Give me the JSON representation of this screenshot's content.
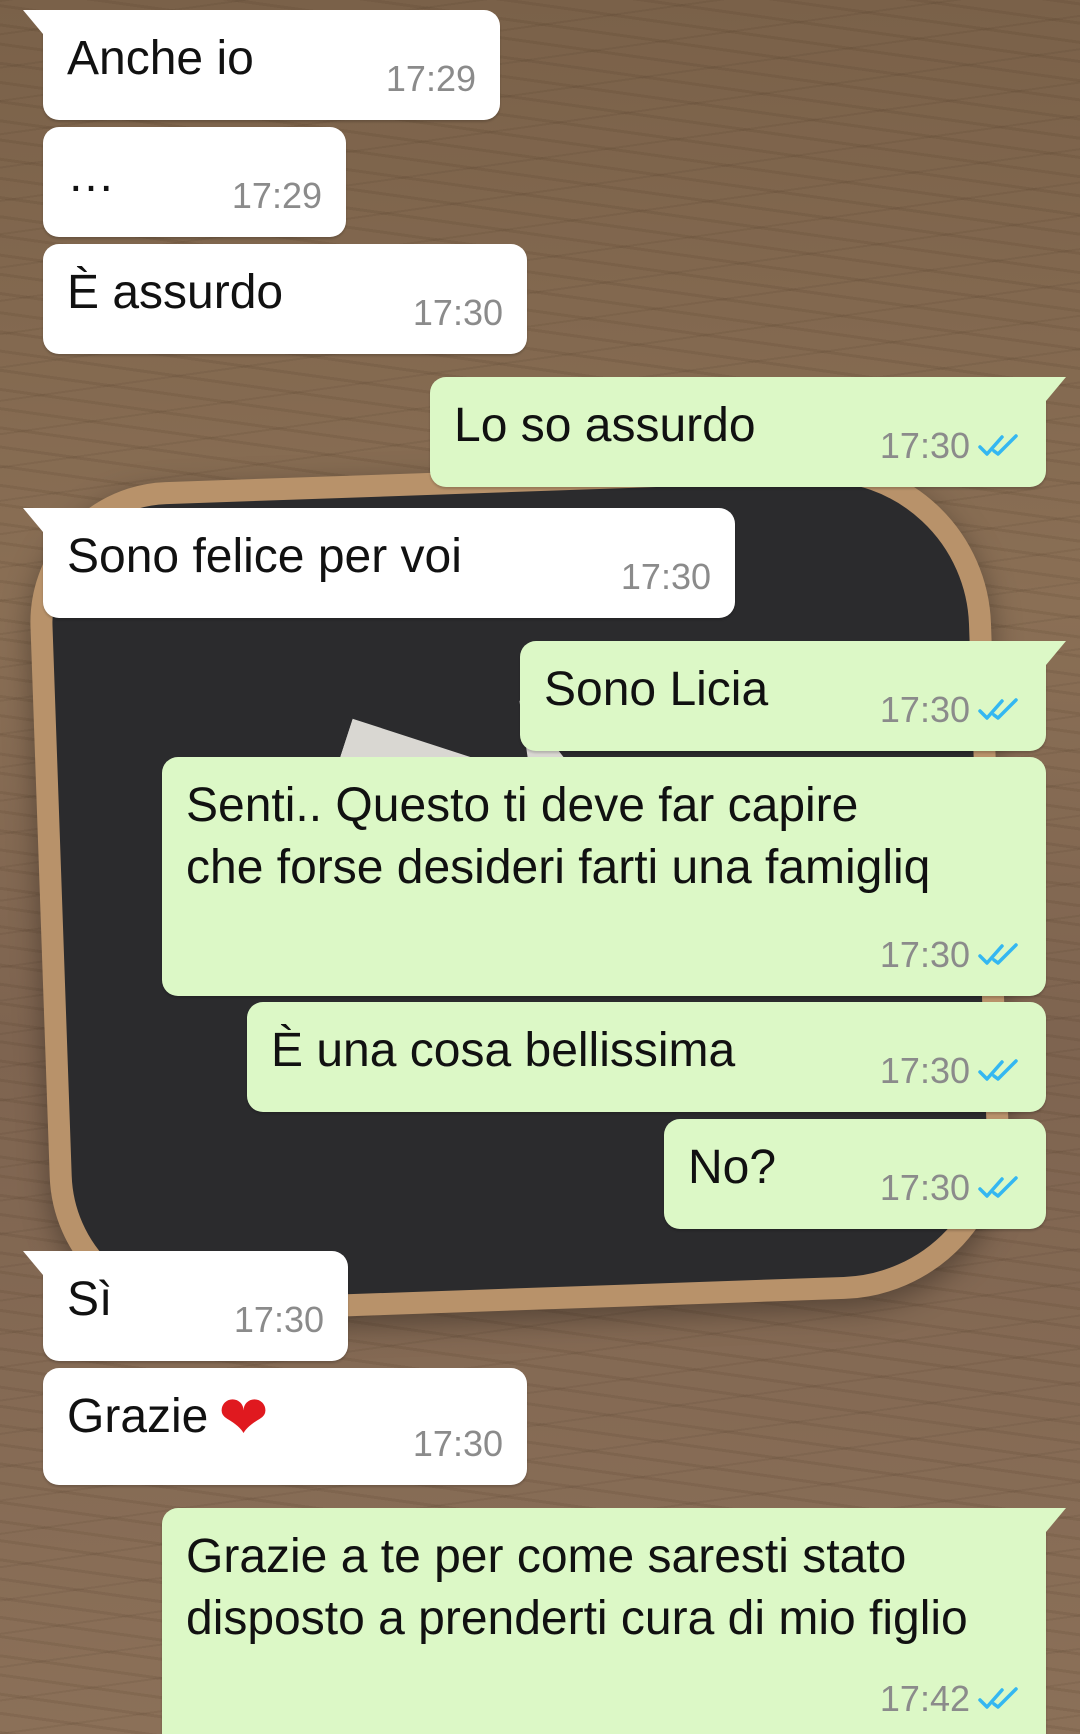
{
  "colors": {
    "incoming_bubble": "#ffffff",
    "outgoing_bubble": "#dcf8c6",
    "timestamp": "#8b8b8b",
    "read_ticks": "#34b7f1",
    "heart": "#e0191f"
  },
  "messages": [
    {
      "direction": "in",
      "text": "Anche io",
      "time": "17:29"
    },
    {
      "direction": "in",
      "text": "…",
      "time": "17:29"
    },
    {
      "direction": "in",
      "text": "È assurdo",
      "time": "17:30"
    },
    {
      "direction": "out",
      "text": "Lo so assurdo",
      "time": "17:30",
      "status": "read"
    },
    {
      "direction": "in",
      "text": "Sono felice per voi",
      "time": "17:30"
    },
    {
      "direction": "out",
      "text": "Sono Licia",
      "time": "17:30",
      "status": "read"
    },
    {
      "direction": "out",
      "text": "Senti.. Questo ti deve far capire che forse desideri farti una famigliq",
      "time": "17:30",
      "status": "read"
    },
    {
      "direction": "out",
      "text": "È una cosa bellissima",
      "time": "17:30",
      "status": "read"
    },
    {
      "direction": "out",
      "text": "No?",
      "time": "17:30",
      "status": "read"
    },
    {
      "direction": "in",
      "text": "Sì",
      "time": "17:30"
    },
    {
      "direction": "in",
      "text": "Grazie",
      "emoji": "❤",
      "time": "17:30"
    },
    {
      "direction": "out",
      "text": "Grazie a te per come saresti stato disposto a prenderti cura di mio figlio",
      "time": "17:42",
      "status": "read"
    }
  ]
}
